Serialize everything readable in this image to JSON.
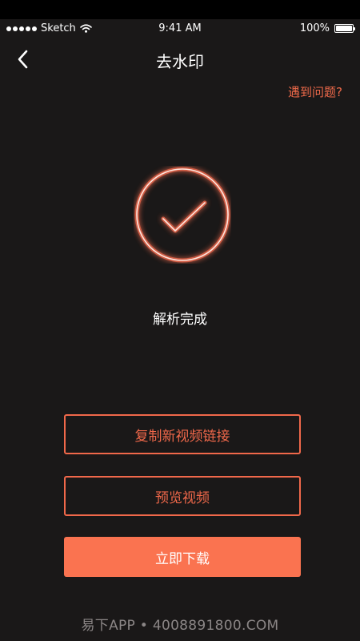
{
  "status_bar": {
    "carrier": "Sketch",
    "time": "9:41 AM",
    "battery_percent": "100%",
    "battery_level": 1.0
  },
  "nav": {
    "back_icon": "chevron-left-icon",
    "title": "去水印"
  },
  "help_link": "遇到问题?",
  "result": {
    "icon": "check-circle-icon",
    "text": "解析完成"
  },
  "actions": {
    "copy_label": "复制新视频链接",
    "preview_label": "预览视频",
    "download_label": "立即下载"
  },
  "footer": {
    "watermark": "易下APP • 4008891800.COM"
  },
  "colors": {
    "background": "#1a1818",
    "accent": "#f0684a",
    "primary_button": "#fa7350",
    "watermark": "#8b8686"
  }
}
